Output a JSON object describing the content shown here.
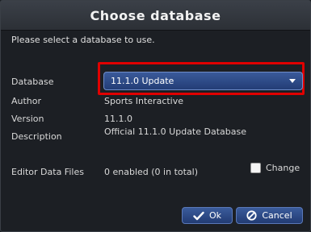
{
  "dialog": {
    "title": "Choose database",
    "intro": "Please select a database to use."
  },
  "fields": {
    "database_label": "Database",
    "database_value": "11.1.0 Update",
    "author_label": "Author",
    "author_value": "Sports Interactive",
    "version_label": "Version",
    "version_value": "11.1.0",
    "description_label": "Description",
    "description_value": "Official 11.1.0 Update Database",
    "editor_label": "Editor Data Files",
    "editor_value": "0 enabled (0 in total)"
  },
  "checkbox": {
    "label": "Change",
    "checked": false
  },
  "buttons": {
    "ok_label": "Ok",
    "cancel_label": "Cancel"
  },
  "icons": {
    "select": "chevron-down-icon",
    "ok": "checkmark-icon",
    "cancel": "cancel-icon"
  },
  "colors": {
    "highlight": "#e00000",
    "accent": "#2c4a86"
  }
}
